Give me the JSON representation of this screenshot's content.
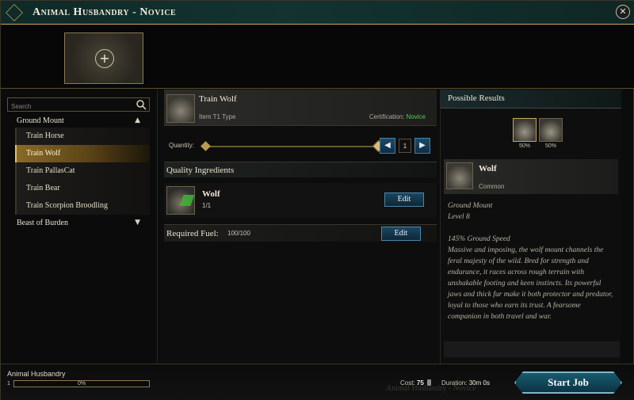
{
  "window": {
    "title": "Animal Husbandry - Novice",
    "close_icon": "close-icon",
    "accent_color": "#c6a65a",
    "title_bg_color": "#123330"
  },
  "header": {
    "add_slot_icon": "plus-icon"
  },
  "search": {
    "placeholder": "Search",
    "icon": "search-icon"
  },
  "categories": [
    {
      "label": "Ground Mount",
      "expanded": true,
      "items": [
        {
          "label": "Train Horse"
        },
        {
          "label": "Train Wolf",
          "selected": true
        },
        {
          "label": "Train PallasCat"
        },
        {
          "label": "Train Bear"
        },
        {
          "label": "Train Scorpion Broodling"
        }
      ]
    },
    {
      "label": "Beast of Burden",
      "expanded": false,
      "items": []
    }
  ],
  "recipe": {
    "title": "Train Wolf",
    "subtitle": "Item T1 Type",
    "cert_label": "Certification:",
    "cert_value": "Novice",
    "cert_color": "#58d04a",
    "icon": "wolf-icon"
  },
  "quantity": {
    "label": "Quantity:",
    "value": "1",
    "slider_level": 0.0
  },
  "quality_ingredients": {
    "label": "Quality Ingredients",
    "items": [
      {
        "name": "Wolf",
        "count": "1/1",
        "edit_label": "Edit",
        "icon": "wolf-icon"
      }
    ]
  },
  "fuel": {
    "label": "Required Fuel:",
    "value": "100/100",
    "edit_label": "Edit"
  },
  "results": {
    "label": "Possible Results",
    "options": [
      {
        "pct": "50%",
        "icon": "wolf-icon"
      },
      {
        "pct": "50%",
        "icon": "wolf-icon"
      }
    ],
    "selected": {
      "name": "Wolf",
      "rarity": "Common",
      "icon": "wolf-icon"
    },
    "type": "Ground Mount",
    "level": "Level 8",
    "stat": "145% Ground Speed",
    "description": "Massive and imposing, the wolf mount channels the feral majesty of the wild. Bred for strength and endurance, it races across rough terrain with unshakable footing and keen instincts. Its powerful jaws and thick fur make it both protector and predator, loyal to those who earn its trust. A fearsome companion in both travel and war."
  },
  "footer": {
    "skill_name": "Animal Husbandry",
    "skill_level": "1",
    "xp_text": "0%",
    "xp_fraction": 0.0,
    "ghost_text": "Animal Husbandry - Novice",
    "cost_label": "Cost:",
    "cost_value": "75",
    "cost_icon": "coin-icon",
    "duration_label": "Duration:",
    "duration_value": "30m 0s",
    "start_label": "Start Job"
  }
}
